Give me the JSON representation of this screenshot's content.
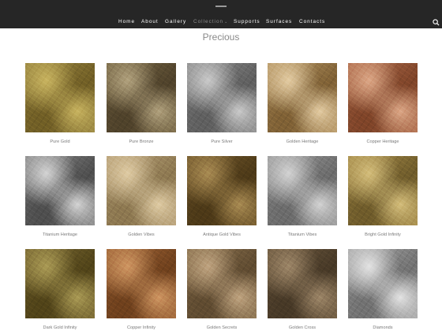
{
  "nav": {
    "items": [
      "Home",
      "About",
      "Gallery",
      "Collection",
      "Supports",
      "Surfaces",
      "Contacts"
    ]
  },
  "page": {
    "title": "Precious"
  },
  "products": [
    {
      "name": "Pure Gold",
      "base": "#9a8742",
      "accent": "#c8b35f",
      "shade": "#6f5d25"
    },
    {
      "name": "Pure Bronze",
      "base": "#7a6a48",
      "accent": "#b0a07c",
      "shade": "#4e412a"
    },
    {
      "name": "Pure Silver",
      "base": "#8e8e8e",
      "accent": "#c9c9c9",
      "shade": "#5e5e5e"
    },
    {
      "name": "Golden Heritage",
      "base": "#b99a69",
      "accent": "#e3cba1",
      "shade": "#7d5f34"
    },
    {
      "name": "Copper Heritage",
      "base": "#b27050",
      "accent": "#dca685",
      "shade": "#7d4328"
    },
    {
      "name": "Titanium Heritage",
      "base": "#8a8a8a",
      "accent": "#d3d3d3",
      "shade": "#4d4d4d"
    },
    {
      "name": "Golden Vibes",
      "base": "#b9a27a",
      "accent": "#dfcba3",
      "shade": "#8b764f"
    },
    {
      "name": "Antique Gold Vibes",
      "base": "#765c2f",
      "accent": "#a88a52",
      "shade": "#4b3817"
    },
    {
      "name": "Titanium Vibes",
      "base": "#9b9b9b",
      "accent": "#d2d2d2",
      "shade": "#6a6a6a"
    },
    {
      "name": "Bright Gold Infinity",
      "base": "#a88e4c",
      "accent": "#d4bd7a",
      "shade": "#6d5a2a"
    },
    {
      "name": "Dark Gold Infinity",
      "base": "#7b6a34",
      "accent": "#a99954",
      "shade": "#4f4218"
    },
    {
      "name": "Copper Infinity",
      "base": "#a2683a",
      "accent": "#cf9561",
      "shade": "#6d3f1c"
    },
    {
      "name": "Golden Secrets",
      "base": "#8c7350",
      "accent": "#bfa37f",
      "shade": "#5e4a30"
    },
    {
      "name": "Golden Cross",
      "base": "#6e5a40",
      "accent": "#9c8567",
      "shade": "#463826"
    },
    {
      "name": "Diamonds",
      "base": "#a9a9a9",
      "accent": "#e3e3e3",
      "shade": "#707070"
    }
  ],
  "icons": {
    "search": "search-icon",
    "logo": "logo-mark"
  }
}
